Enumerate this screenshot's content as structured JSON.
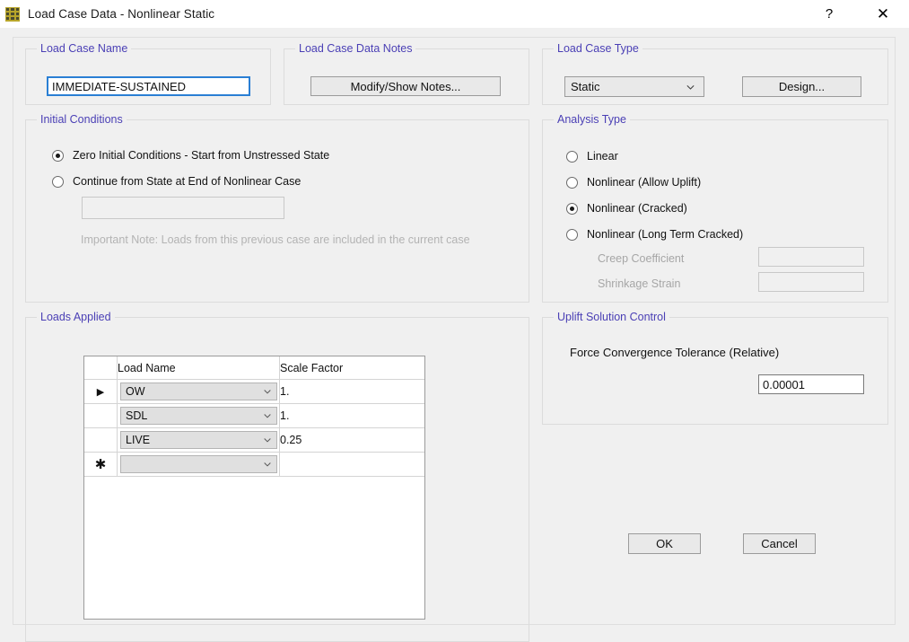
{
  "window": {
    "title": "Load Case Data - Nonlinear Static",
    "icon": "app-grid-icon",
    "help_label": "?",
    "close_label": "✕"
  },
  "load_case_name": {
    "group_title": "Load Case Name",
    "value": "IMMEDIATE-SUSTAINED"
  },
  "notes": {
    "group_title": "Load Case Data Notes",
    "button_label": "Modify/Show Notes..."
  },
  "load_case_type": {
    "group_title": "Load Case Type",
    "selected": "Static",
    "options": [
      "Static"
    ],
    "design_button_label": "Design..."
  },
  "initial_conditions": {
    "group_title": "Initial Conditions",
    "options": [
      {
        "label": "Zero Initial Conditions - Start from Unstressed State",
        "selected": true
      },
      {
        "label": "Continue from State at End of Nonlinear Case",
        "selected": false
      }
    ],
    "previous_case_value": "",
    "note": "Important Note:  Loads from this previous case are included in the current case"
  },
  "analysis_type": {
    "group_title": "Analysis Type",
    "options": [
      {
        "label": "Linear",
        "selected": false
      },
      {
        "label": "Nonlinear (Allow Uplift)",
        "selected": false
      },
      {
        "label": "Nonlinear (Cracked)",
        "selected": true
      },
      {
        "label": "Nonlinear (Long Term Cracked)",
        "selected": false
      }
    ],
    "creep_label": "Creep Coefficient",
    "creep_value": "",
    "shrinkage_label": "Shrinkage Strain",
    "shrinkage_value": ""
  },
  "loads_applied": {
    "group_title": "Loads Applied",
    "columns": [
      "",
      "Load Name",
      "Scale Factor"
    ],
    "rows": [
      {
        "marker": "▶",
        "load_name": "OW",
        "scale_factor": "1."
      },
      {
        "marker": "",
        "load_name": "SDL",
        "scale_factor": "1."
      },
      {
        "marker": "",
        "load_name": "LIVE",
        "scale_factor": "0.25"
      },
      {
        "marker": "✱",
        "load_name": "",
        "scale_factor": ""
      }
    ]
  },
  "uplift_solution_control": {
    "group_title": "Uplift Solution Control",
    "tolerance_label": "Force Convergence Tolerance (Relative)",
    "tolerance_value": "0.00001"
  },
  "dialog_buttons": {
    "ok_label": "OK",
    "cancel_label": "Cancel"
  },
  "colors": {
    "group_title": "#4a3fb5",
    "window_bg": "#f0f0f0",
    "titlebar_bg": "#ffffff",
    "focus_border": "#2a7fd4",
    "disabled_text": "#a6a6a6"
  }
}
